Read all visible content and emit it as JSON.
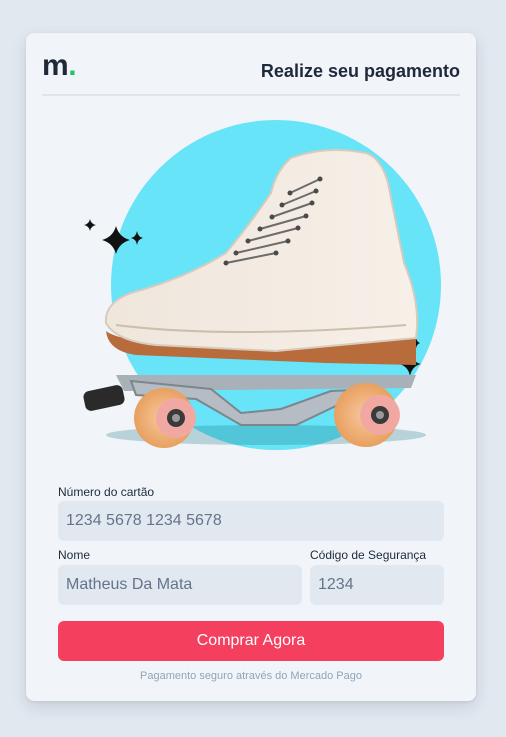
{
  "brand": {
    "logo_letter": "m",
    "logo_dot": ".",
    "accent": "#22c55e"
  },
  "header": {
    "title": "Realize seu pagamento"
  },
  "hero": {
    "image": "roller-skate",
    "circle_color": "#67e4f7"
  },
  "form": {
    "card_number": {
      "label": "Número do cartão",
      "placeholder": "1234 5678 1234 5678",
      "value": ""
    },
    "name": {
      "label": "Nome",
      "placeholder": "Matheus Da Mata",
      "value": ""
    },
    "security_code": {
      "label": "Código de Segurança",
      "placeholder": "1234",
      "value": ""
    }
  },
  "actions": {
    "buy_label": "Comprar Agora",
    "buy_color": "#f43f5e"
  },
  "footer": {
    "note": "Pagamento seguro através do Mercado Pago"
  }
}
